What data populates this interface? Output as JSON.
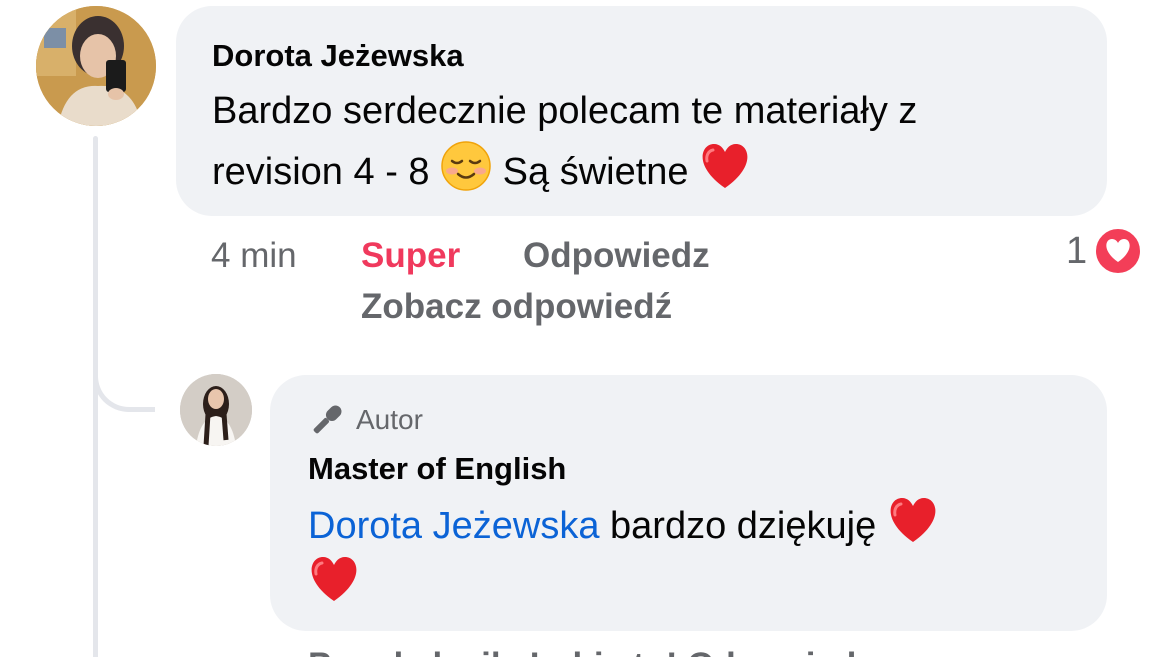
{
  "comment": {
    "author": "Dorota Jeżewska",
    "text_line1": "Bardzo serdecznie polecam te materiały z",
    "text_line2_start": "revision 4 - 8",
    "text_line2_mid": "Są świetne",
    "time": "4 min",
    "like_label": "Super",
    "reply_label": "Odpowiedz",
    "see_replies_label": "Zobacz odpowiedź",
    "reaction_count": "1",
    "reaction_color": "#f33e58"
  },
  "reply": {
    "badge": "Autor",
    "author": "Master of English",
    "mention": "Dorota Jeżewska",
    "text": "bardzo dziękuję",
    "mention_color": "#0b63d6",
    "partial_row": "Przed chwilą   Lubię to!   Odpowiedz"
  },
  "icons": [
    "avatar",
    "microphone-icon",
    "heart-emoji",
    "smiling-face-emoji",
    "heart-reaction-icon"
  ]
}
